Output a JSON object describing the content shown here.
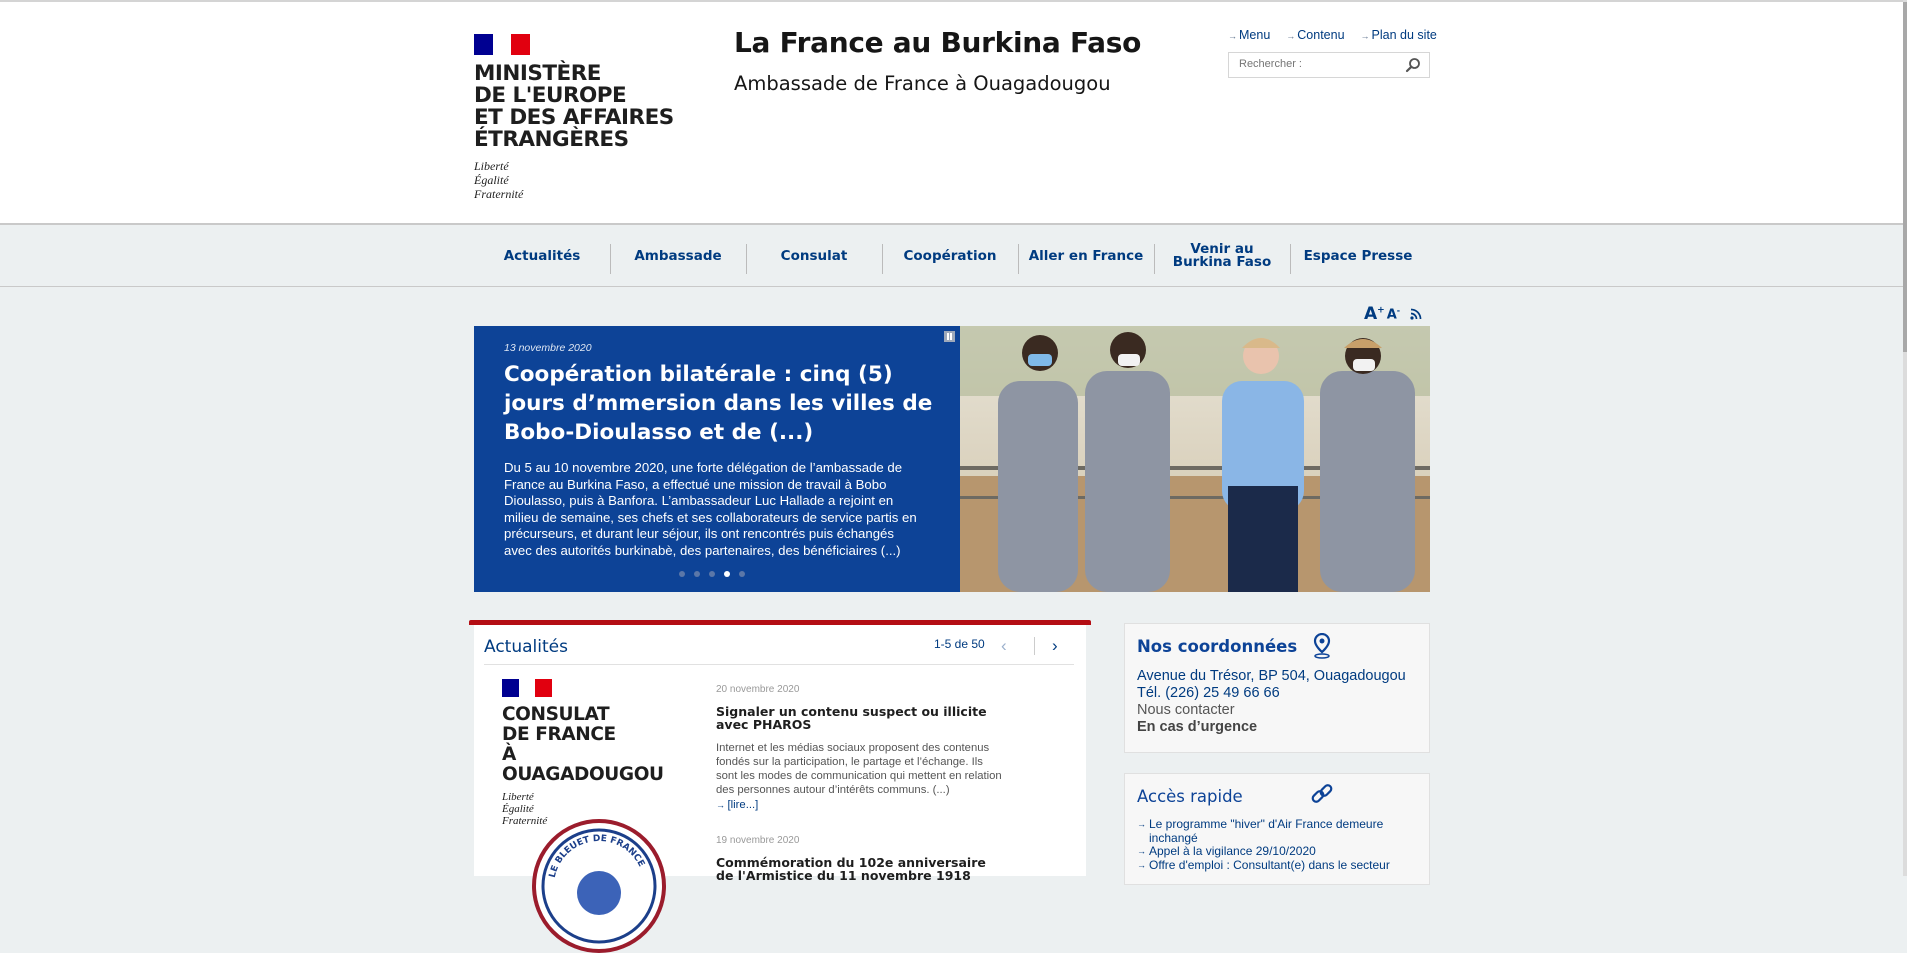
{
  "header": {
    "ministry_lines": [
      "MINISTÈRE",
      "DE L'EUROPE",
      "ET DES AFFAIRES",
      "ÉTRANGÈRES"
    ],
    "motto_lines": [
      "Liberté",
      "Égalité",
      "Fraternité"
    ],
    "site_title": "La France au Burkina Faso",
    "site_subtitle": "Ambassade de France à Ouagadougou",
    "toplinks": [
      "Menu",
      "Contenu",
      "Plan du site"
    ],
    "search_placeholder": "Rechercher :"
  },
  "nav": {
    "items": [
      "Actualités",
      "Ambassade",
      "Consulat",
      "Coopération",
      "Aller en France",
      "Venir au Burkina Faso",
      "Espace Presse"
    ]
  },
  "tools": {
    "font_up": "A",
    "font_up_sup": "+",
    "font_down": "A",
    "font_down_sup": "-"
  },
  "slider": {
    "date": "13 novembre 2020",
    "title": "Coopération bilatérale : cinq (5) jours d’mmersion dans les villes de Bobo-Dioulasso et de (...)",
    "body": "Du 5 au 10 novembre 2020, une forte délégation de l’ambassade de France au Burkina Faso, a effectué une mission de travail à Bobo Dioulasso, puis à Banfora. L’ambassadeur Luc Hallade a rejoint en milieu de semaine, ses chefs et ses collaborateurs de service partis en précurseurs, et durant leur séjour, ils ont rencontrés puis échangés avec des autorités burkinabè, des partenaires, des bénéficiaires (...)",
    "dot_count": 5,
    "active_dot": 4
  },
  "news": {
    "heading": "Actualités",
    "pager": "1-5 de 50",
    "thumb_title_lines": [
      "CONSULAT",
      "DE FRANCE",
      "À OUAGADOUGOU"
    ],
    "thumb_motto_lines": [
      "Liberté",
      "Égalité",
      "Fraternité"
    ],
    "badge_text": "LE BLEUET DE FRANCE",
    "items": [
      {
        "date": "20 novembre 2020",
        "title": "Signaler un contenu suspect ou illicite avec PHAROS",
        "text": "Internet et les médias sociaux proposent des contenus fondés sur la participation, le partage et l’échange. Ils sont les modes de communication qui mettent en relation des personnes autour d’intérêts communs. (...)",
        "more": "[lire...]"
      },
      {
        "date": "19 novembre 2020",
        "title": "Commémoration du 102e anniversaire de l'Armistice du 11 novembre 1918"
      }
    ]
  },
  "coordonnees": {
    "heading": "Nos coordonnées",
    "address": "Avenue du Trésor, BP 504, Ouagadougou",
    "phone": "Tél. (226) 25 49 66 66",
    "contact": "Nous contacter",
    "urgence": "En cas d’urgence"
  },
  "acces": {
    "heading": "Accès rapide",
    "links": [
      "Le programme \"hiver\" d'Air France demeure inchangé",
      "Appel à la vigilance 29/10/2020",
      "Offre d'emploi : Consultant(e) dans le secteur"
    ]
  },
  "colors": {
    "brand_blue": "#0d4397",
    "link_blue": "#003b80",
    "accent_red": "#b40e14",
    "flag_blue": "#000091",
    "flag_red": "#e1000f"
  }
}
